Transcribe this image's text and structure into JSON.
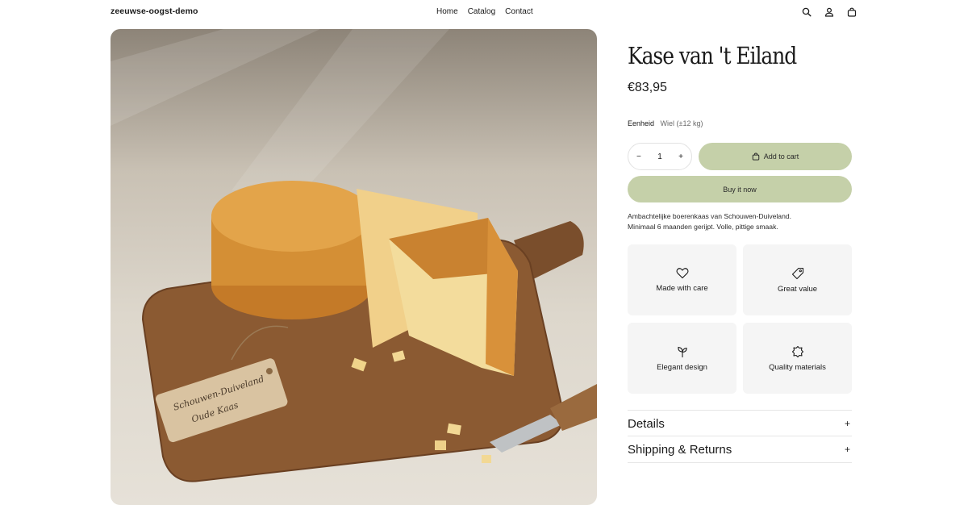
{
  "header": {
    "brand": "zeeuwse-oogst-demo",
    "nav": [
      "Home",
      "Catalog",
      "Contact"
    ],
    "icons": [
      "search-icon",
      "account-icon",
      "cart-icon"
    ]
  },
  "product": {
    "title": "Kase van 't Eiland",
    "price": "€83,95",
    "variant_label": "Eenheid",
    "variant_value": "Wiel (±12 kg)",
    "quantity": "1",
    "decrement": "−",
    "increment": "+",
    "add_to_cart": "Add to cart",
    "buy_now": "Buy it now",
    "description_line1": "Ambachtelijke boerenkaas van Schouwen-Duiveland.",
    "description_line2": "Minimaal 6 maanden gerijpt. Volle, pittige smaak.",
    "image_tag_line1": "Schouwen-Duiveland",
    "image_tag_line2": "Oude Kaas"
  },
  "features": [
    {
      "label": "Made with care",
      "icon": "heart-icon"
    },
    {
      "label": "Great value",
      "icon": "tag-icon"
    },
    {
      "label": "Elegant design",
      "icon": "sprout-icon"
    },
    {
      "label": "Quality materials",
      "icon": "badge-icon"
    }
  ],
  "accordions": [
    {
      "label": "Details",
      "toggle": "+"
    },
    {
      "label": "Shipping & Returns",
      "toggle": "+"
    }
  ],
  "colors": {
    "accent": "#c5d0a9",
    "feature_bg": "#f5f5f5"
  }
}
